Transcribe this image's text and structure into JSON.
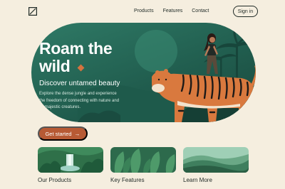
{
  "header": {
    "nav": [
      "Products",
      "Features",
      "Contact"
    ],
    "sign_in_label": "Sign in",
    "logo_icon": "logo-slash-icon"
  },
  "hero": {
    "title": "Roam the wild",
    "subtitle": "Discover untamed beauty",
    "description": "Explore the dense jungle and experience the freedom of connecting with nature and its majestic creatures.",
    "accent_color": "#d4733f",
    "bg_color": "#215e4f"
  },
  "cta": {
    "label": "Get started",
    "icon": "arrow-right-icon",
    "color": "#b75a34"
  },
  "cards": [
    {
      "label": "Our Products",
      "image": "jungle-waterfall-image"
    },
    {
      "label": "Key Features",
      "image": "tropical-leaves-image"
    },
    {
      "label": "Learn More",
      "image": "forest-hills-image"
    }
  ],
  "colors": {
    "page_bg": "#f5eedf",
    "text": "#1f2a26"
  }
}
